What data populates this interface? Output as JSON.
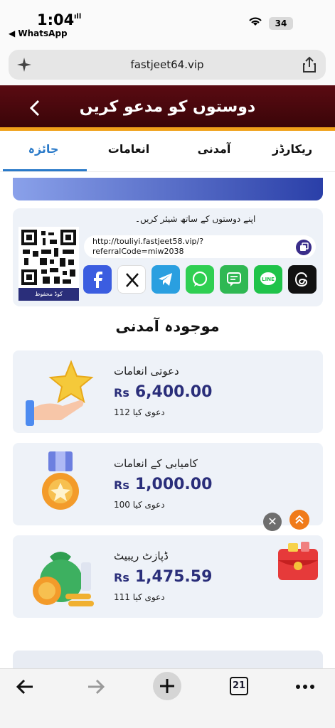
{
  "status_bar": {
    "time": "1:04",
    "back_app": "◀ WhatsApp",
    "battery": "34"
  },
  "browser": {
    "url": "fastjeet64.vip",
    "tab_count": "21"
  },
  "header": {
    "title": "دوستوں کو مدعو کریں"
  },
  "tabs": [
    {
      "label": "جائزہ",
      "active": true
    },
    {
      "label": "انعامات",
      "active": false
    },
    {
      "label": "آمدنی",
      "active": false
    },
    {
      "label": "ریکارڈز",
      "active": false
    }
  ],
  "share": {
    "title": "اپنے دوستوں کے ساتھ شیئر کریں۔",
    "qr_caption": "کوڈ محفوظ",
    "link_line1": "http://touliyi.fastjeet58.vip/?",
    "link_line2": "referralCode=miw2038",
    "socials": [
      {
        "name": "facebook",
        "color": "#3b5de0"
      },
      {
        "name": "x",
        "color": "#ffffff"
      },
      {
        "name": "telegram",
        "color": "#2a9fe0"
      },
      {
        "name": "whatsapp",
        "color": "#2fcf52"
      },
      {
        "name": "sms",
        "color": "#2fb853"
      },
      {
        "name": "line",
        "color": "#1fc34a"
      },
      {
        "name": "threads",
        "color": "#111111"
      }
    ]
  },
  "section": {
    "title": "موجودہ آمدنی"
  },
  "cards": [
    {
      "label": "دعوتی انعامات",
      "currency": "Rs",
      "amount": "6,400.00",
      "claim": "دعوی کیا 112"
    },
    {
      "label": "کامیابی کے انعامات",
      "currency": "Rs",
      "amount": "1,000.00",
      "claim": "دعوی کیا 100"
    },
    {
      "label": "ڈپازٹ ریبیٹ",
      "currency": "Rs",
      "amount": "1,475.59",
      "claim": "دعوی کیا 111"
    }
  ]
}
